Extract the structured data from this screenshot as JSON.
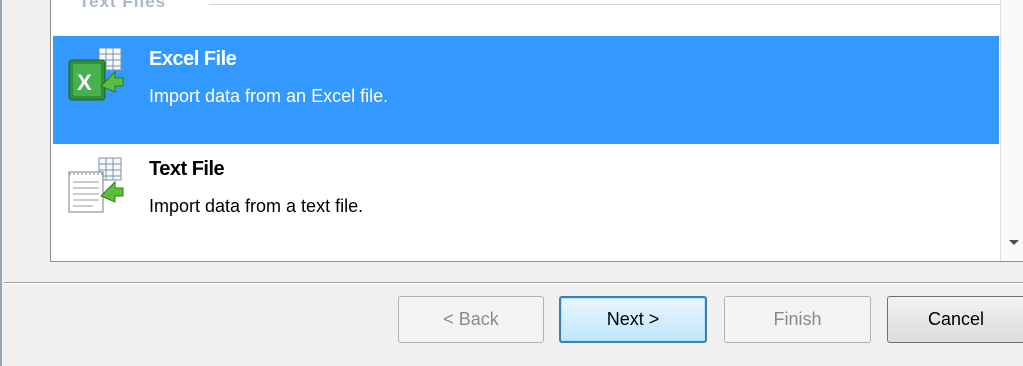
{
  "group": {
    "label": "Text Files"
  },
  "items": [
    {
      "title": "Excel File",
      "description": "Import data from an Excel file.",
      "icon": "excel-import-icon",
      "selected": true
    },
    {
      "title": "Text File",
      "description": "Import data from a text file.",
      "icon": "text-file-import-icon",
      "selected": false
    }
  ],
  "buttons": {
    "back": "< Back",
    "next": "Next >",
    "finish": "Finish",
    "cancel": "Cancel"
  },
  "colors": {
    "selection": "#3399ff",
    "default_button_border": "#3c7fb1"
  }
}
